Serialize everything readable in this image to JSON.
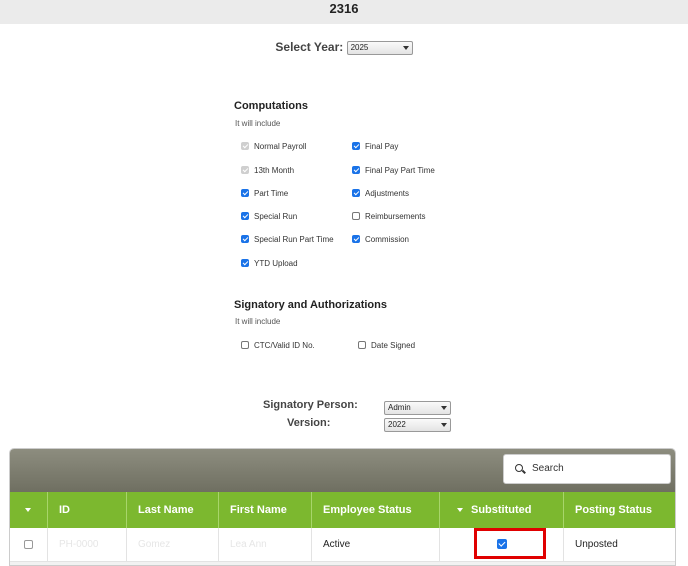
{
  "header": {
    "title": "2316"
  },
  "year": {
    "label": "Select Year:",
    "value": "2025"
  },
  "computations": {
    "title": "Computations",
    "subtitle": "It will include",
    "items": [
      {
        "label": "Normal Payroll",
        "state": "disabled"
      },
      {
        "label": "13th Month",
        "state": "disabled"
      },
      {
        "label": "Part Time",
        "state": "checked"
      },
      {
        "label": "Special Run",
        "state": "checked"
      },
      {
        "label": "Special Run Part Time",
        "state": "checked"
      },
      {
        "label": "YTD Upload",
        "state": "checked"
      },
      {
        "label": "Final Pay",
        "state": "checked"
      },
      {
        "label": "Final Pay Part Time",
        "state": "checked"
      },
      {
        "label": "Adjustments",
        "state": "checked"
      },
      {
        "label": "Reimbursements",
        "state": "unchecked"
      },
      {
        "label": "Commission",
        "state": "checked"
      }
    ]
  },
  "signatory": {
    "title": "Signatory and Authorizations",
    "subtitle": "It will include",
    "items": [
      {
        "label": "CTC/Valid ID No.",
        "state": "unchecked"
      },
      {
        "label": "Date Signed",
        "state": "unchecked"
      }
    ],
    "person_label": "Signatory Person:",
    "person_value": "Admin",
    "version_label": "Version:",
    "version_value": "2022"
  },
  "grid": {
    "search_placeholder": "Search",
    "columns": [
      "ID",
      "Last Name",
      "First Name",
      "Employee Status",
      "Substituted",
      "Posting Status"
    ],
    "rows": [
      {
        "id": "PH-0000",
        "last_name": "Gomez",
        "first_name": "Lea Ann",
        "employee_status": "Active",
        "substituted": true,
        "posting_status": "Unposted"
      }
    ]
  },
  "colors": {
    "header_green": "#7cb82f",
    "checkbox_blue": "#1a73e8",
    "highlight_red": "#e00000"
  }
}
